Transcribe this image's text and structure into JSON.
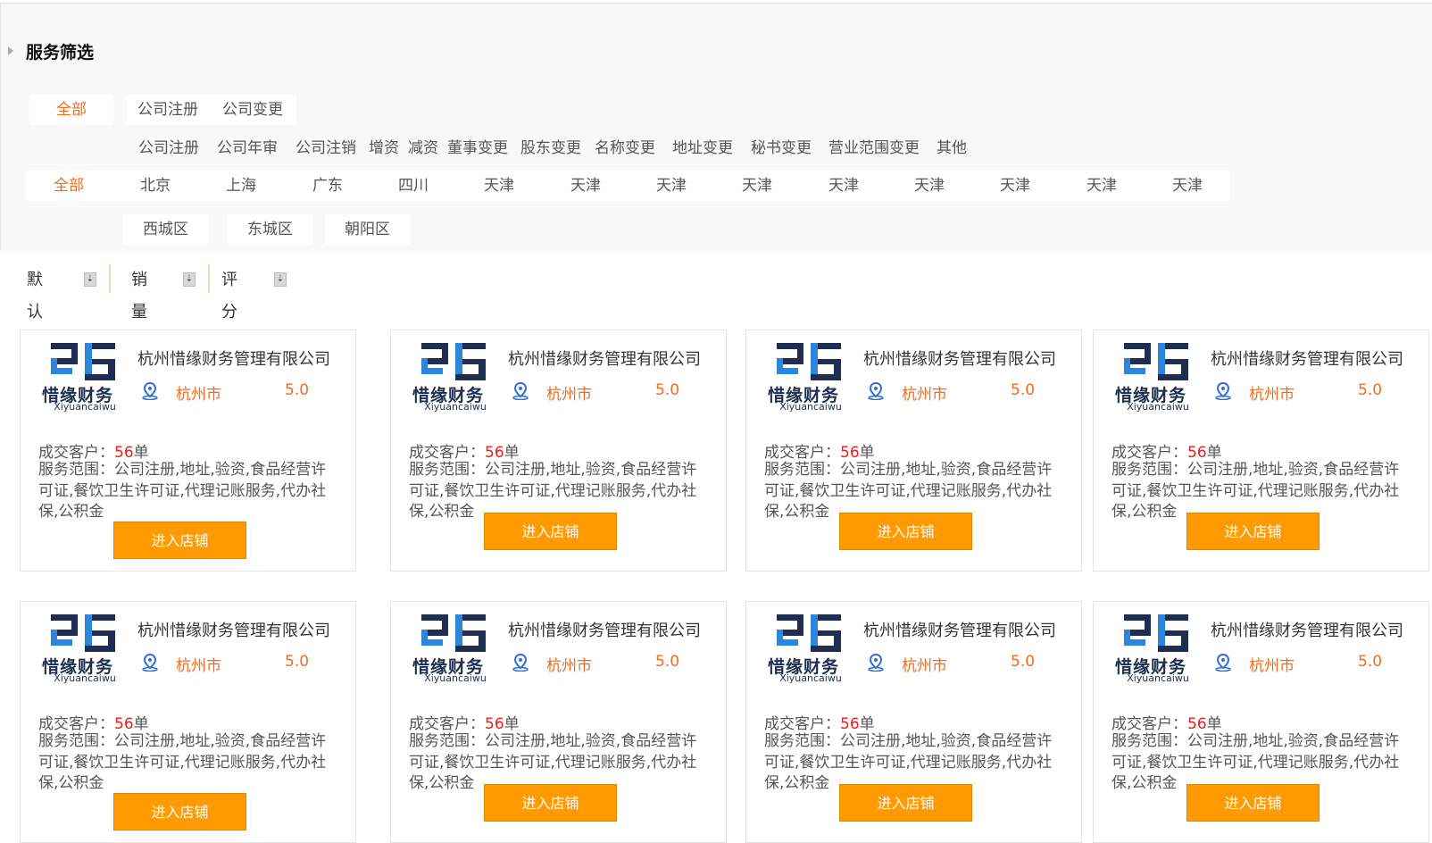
{
  "filter": {
    "title": "服务筛选",
    "service_categories": [
      "全部",
      "公司注册",
      "公司变更"
    ],
    "service_sub_items": [
      "公司注册",
      "公司年审",
      "公司注销",
      "增资",
      "减资",
      "董事变更",
      "股东变更",
      "名称变更",
      "地址变更",
      "秘书变更",
      "营业范围变更",
      "其他"
    ],
    "regions": [
      "全部",
      "北京",
      "上海",
      "广东",
      "四川",
      "天津",
      "天津",
      "天津",
      "天津",
      "天津",
      "天津",
      "天津",
      "天津",
      "天津"
    ],
    "districts": [
      "西城区",
      "东城区",
      "朝阳区"
    ]
  },
  "sort": {
    "items": [
      {
        "label": "默认"
      },
      {
        "label": "销量"
      },
      {
        "label": "评分"
      }
    ]
  },
  "cards": [
    {
      "logo_cn": "惜缘财务",
      "logo_en": "Xiyuancaiwu",
      "company": "杭州惜缘财务管理有限公司",
      "city": "杭州市",
      "score": "5.0",
      "deals_label": "成交客户：",
      "deals_num": "56",
      "deals_unit": "单",
      "scope": "服务范围：公司注册,地址,验资,食品经营许可证,餐饮卫生许可证,代理记账服务,代办社保,公积金",
      "button": "进入店铺"
    },
    {
      "logo_cn": "惜缘财务",
      "logo_en": "Xiyuancaiwu",
      "company": "杭州惜缘财务管理有限公司",
      "city": "杭州市",
      "score": "5.0",
      "deals_label": "成交客户：",
      "deals_num": "56",
      "deals_unit": "单",
      "scope": "服务范围：公司注册,地址,验资,食品经营许可证,餐饮卫生许可证,代理记账服务,代办社保,公积金",
      "button": "进入店铺"
    },
    {
      "logo_cn": "惜缘财务",
      "logo_en": "Xiyuancaiwu",
      "company": "杭州惜缘财务管理有限公司",
      "city": "杭州市",
      "score": "5.0",
      "deals_label": "成交客户：",
      "deals_num": "56",
      "deals_unit": "单",
      "scope": "服务范围：公司注册,地址,验资,食品经营许可证,餐饮卫生许可证,代理记账服务,代办社保,公积金",
      "button": "进入店铺"
    },
    {
      "logo_cn": "惜缘财务",
      "logo_en": "Xiyuancaiwu",
      "company": "杭州惜缘财务管理有限公司",
      "city": "杭州市",
      "score": "5.0",
      "deals_label": "成交客户：",
      "deals_num": "56",
      "deals_unit": "单",
      "scope": "服务范围：公司注册,地址,验资,食品经营许可证,餐饮卫生许可证,代理记账服务,代办社保,公积金",
      "button": "进入店铺"
    },
    {
      "logo_cn": "惜缘财务",
      "logo_en": "Xiyuancaiwu",
      "company": "杭州惜缘财务管理有限公司",
      "city": "杭州市",
      "score": "5.0",
      "deals_label": "成交客户：",
      "deals_num": "56",
      "deals_unit": "单",
      "scope": "服务范围：公司注册,地址,验资,食品经营许可证,餐饮卫生许可证,代理记账服务,代办社保,公积金",
      "button": "进入店铺"
    },
    {
      "logo_cn": "惜缘财务",
      "logo_en": "Xiyuancaiwu",
      "company": "杭州惜缘财务管理有限公司",
      "city": "杭州市",
      "score": "5.0",
      "deals_label": "成交客户：",
      "deals_num": "56",
      "deals_unit": "单",
      "scope": "服务范围：公司注册,地址,验资,食品经营许可证,餐饮卫生许可证,代理记账服务,代办社保,公积金",
      "button": "进入店铺"
    },
    {
      "logo_cn": "惜缘财务",
      "logo_en": "Xiyuancaiwu",
      "company": "杭州惜缘财务管理有限公司",
      "city": "杭州市",
      "score": "5.0",
      "deals_label": "成交客户：",
      "deals_num": "56",
      "deals_unit": "单",
      "scope": "服务范围：公司注册,地址,验资,食品经营许可证,餐饮卫生许可证,代理记账服务,代办社保,公积金",
      "button": "进入店铺"
    },
    {
      "logo_cn": "惜缘财务",
      "logo_en": "Xiyuancaiwu",
      "company": "杭州惜缘财务管理有限公司",
      "city": "杭州市",
      "score": "5.0",
      "deals_label": "成交客户：",
      "deals_num": "56",
      "deals_unit": "单",
      "scope": "服务范围：公司注册,地址,验资,食品经营许可证,餐饮卫生许可证,代理记账服务,代办社保,公积金",
      "button": "进入店铺"
    }
  ],
  "colors": {
    "accent": "#f26b1d",
    "button": "#ff9a00",
    "deal_number": "#e52020",
    "logo": "#1e2d50"
  },
  "icons": {
    "location": "location-pin-icon",
    "sort": "sort-arrow-icon",
    "panel": "triangle-right-icon"
  }
}
